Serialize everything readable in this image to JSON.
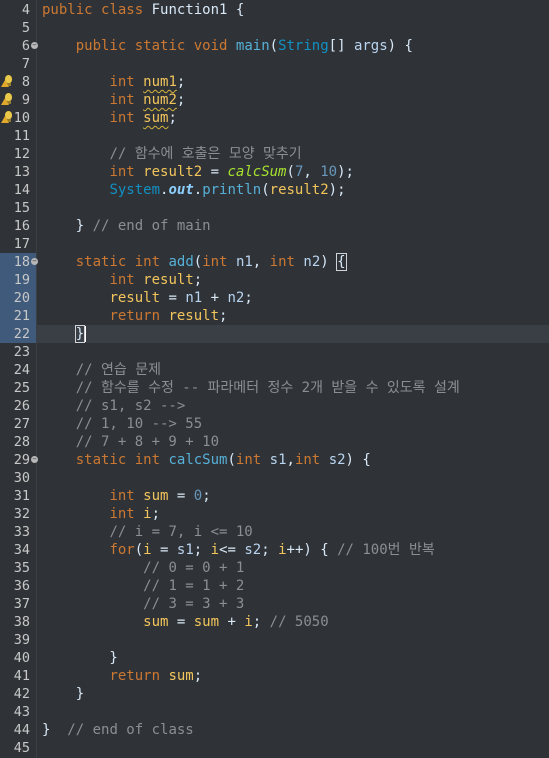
{
  "editor": {
    "lines": [
      {
        "n": "4",
        "text": "public class Function1 {"
      },
      {
        "n": "5",
        "text": ""
      },
      {
        "n": "6",
        "text": "    public static void main(String[] args) {"
      },
      {
        "n": "7",
        "text": ""
      },
      {
        "n": "8",
        "text": "        int num1;"
      },
      {
        "n": "9",
        "text": "        int num2;"
      },
      {
        "n": "10",
        "text": "        int sum;"
      },
      {
        "n": "11",
        "text": ""
      },
      {
        "n": "12",
        "text": "        // 함수에 호출은 모양 맞추기"
      },
      {
        "n": "13",
        "text": "        int result2 = calcSum(7, 10);"
      },
      {
        "n": "14",
        "text": "        System.out.println(result2);"
      },
      {
        "n": "15",
        "text": ""
      },
      {
        "n": "16",
        "text": "    } // end of main"
      },
      {
        "n": "17",
        "text": ""
      },
      {
        "n": "18",
        "text": "    static int add(int n1, int n2) {"
      },
      {
        "n": "19",
        "text": "        int result;"
      },
      {
        "n": "20",
        "text": "        result = n1 + n2;"
      },
      {
        "n": "21",
        "text": "        return result;"
      },
      {
        "n": "22",
        "text": "    }"
      },
      {
        "n": "23",
        "text": ""
      },
      {
        "n": "24",
        "text": "    // 연습 문제"
      },
      {
        "n": "25",
        "text": "    // 함수를 수정 -- 파라메터 정수 2개 받을 수 있도록 설계"
      },
      {
        "n": "26",
        "text": "    // s1, s2 -->"
      },
      {
        "n": "27",
        "text": "    // 1, 10 --> 55"
      },
      {
        "n": "28",
        "text": "    // 7 + 8 + 9 + 10"
      },
      {
        "n": "29",
        "text": "    static int calcSum(int s1,int s2) {"
      },
      {
        "n": "30",
        "text": ""
      },
      {
        "n": "31",
        "text": "        int sum = 0;"
      },
      {
        "n": "32",
        "text": "        int i;"
      },
      {
        "n": "33",
        "text": "        // i = 7, i <= 10"
      },
      {
        "n": "34",
        "text": "        for(i = s1; i<= s2; i++) { // 100번 반복"
      },
      {
        "n": "35",
        "text": "            // 0 = 0 + 1"
      },
      {
        "n": "36",
        "text": "            // 1 = 1 + 2"
      },
      {
        "n": "37",
        "text": "            // 3 = 3 + 3"
      },
      {
        "n": "38",
        "text": "            sum = sum + i; // 5050"
      },
      {
        "n": "39",
        "text": ""
      },
      {
        "n": "40",
        "text": "        }"
      },
      {
        "n": "41",
        "text": "        return sum;"
      },
      {
        "n": "42",
        "text": "    }"
      },
      {
        "n": "43",
        "text": ""
      },
      {
        "n": "44",
        "text": "}  // end of class"
      },
      {
        "n": "45",
        "text": ""
      }
    ],
    "warning_lines": [
      "8",
      "9",
      "10"
    ],
    "fold_lines": [
      "6",
      "18",
      "29"
    ],
    "current_line": "22",
    "selected_gutter_lines": [
      "18",
      "19",
      "20",
      "21",
      "22"
    ],
    "colors": {
      "background": "#2f3337",
      "keyword": "#cc7832",
      "comment": "#8a8f94",
      "method": "#56b0d8",
      "number": "#6897bb",
      "variable": "#f2c55c",
      "warning": "#e0a92b"
    },
    "icons": {
      "warning": "lightbulb-warning-icon",
      "fold": "fold-collapse-icon"
    }
  }
}
